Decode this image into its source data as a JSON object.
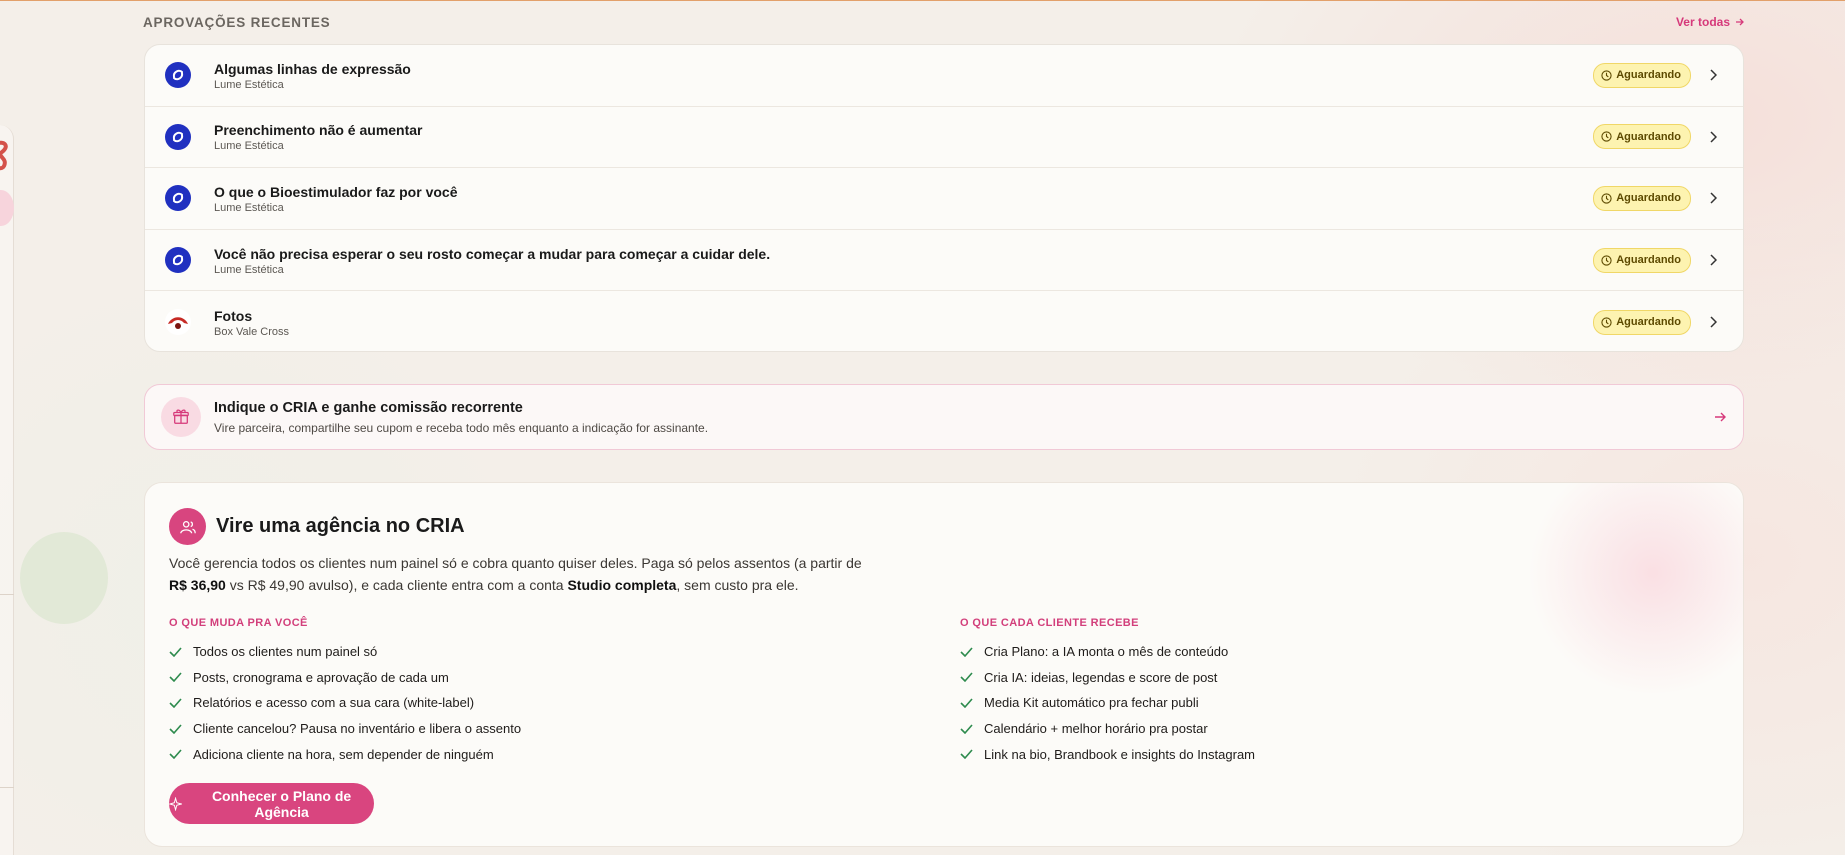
{
  "section": {
    "title": "APROVAÇÕES RECENTES",
    "see_all": "Ver todas"
  },
  "approvals": [
    {
      "title": "Algumas linhas de expressão",
      "client": "Lume Estética",
      "status": "Aguardando",
      "avatar_icon": "lume-logo-icon"
    },
    {
      "title": "Preenchimento não é aumentar",
      "client": "Lume Estética",
      "status": "Aguardando",
      "avatar_icon": "lume-logo-icon"
    },
    {
      "title": "O que o Bioestimulador faz por você",
      "client": "Lume Estética",
      "status": "Aguardando",
      "avatar_icon": "lume-logo-icon"
    },
    {
      "title": "Você não precisa esperar o seu rosto começar a mudar para começar a cuidar dele.",
      "client": "Lume Estética",
      "status": "Aguardando",
      "avatar_icon": "lume-logo-icon"
    },
    {
      "title": "Fotos",
      "client": "Box Vale Cross",
      "status": "Aguardando",
      "avatar_icon": "box-vale-cross-logo-icon"
    }
  ],
  "referral": {
    "title": "Indique o CRIA e ganhe comissão recorrente",
    "subtitle": "Vire parceira, compartilhe seu cupom e receba todo mês enquanto a indicação for assinante."
  },
  "agency": {
    "title": "Vire uma agência no CRIA",
    "desc_part1": "Você gerencia todos os clientes num painel só e cobra quanto quiser deles. Paga só pelos assentos (a partir de ",
    "desc_price": "R$ 36,90",
    "desc_part2": " vs R$ 49,90 avulso), e cada cliente entra com a conta ",
    "desc_plan": "Studio completa",
    "desc_part3": ", sem custo pra ele.",
    "col_a_title": "O QUE MUDA PRA VOCÊ",
    "col_a_items": [
      "Todos os clientes num painel só",
      "Posts, cronograma e aprovação de cada um",
      "Relatórios e acesso com a sua cara (white-label)",
      "Cliente cancelou? Pausa no inventário e libera o assento",
      "Adiciona cliente na hora, sem depender de ninguém"
    ],
    "col_b_title": "O QUE CADA CLIENTE RECEBE",
    "col_b_items": [
      "Cria Plano: a IA monta o mês de conteúdo",
      "Cria IA: ideias, legendas e score de post",
      "Media Kit automático pra fechar publi",
      "Calendário + melhor horário pra postar",
      "Link na bio, Brandbook e insights do Instagram"
    ],
    "cta": "Conhecer o Plano de Agência"
  },
  "colors": {
    "accent": "#d9457f",
    "badge_bg": "#fdf3b0",
    "check": "#2e8b4e"
  }
}
